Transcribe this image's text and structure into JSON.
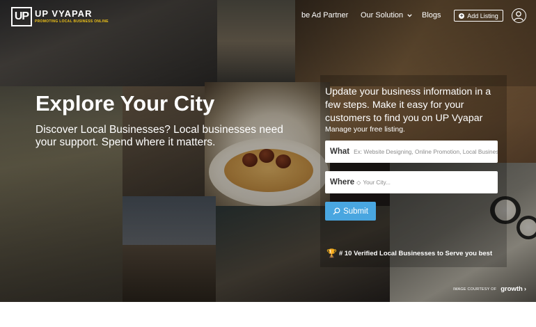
{
  "brand": {
    "logo_mark": "UP",
    "name": "UP VYAPAR",
    "tagline": "PROMOTING LOCAL BUSINESS ONLINE"
  },
  "nav": {
    "items": [
      {
        "label": "be Ad Partner"
      },
      {
        "label": "Our Solution"
      },
      {
        "label": "Blogs"
      }
    ],
    "add_listing": "Add Listing"
  },
  "hero": {
    "title": "Explore Your City",
    "subtitle": "Discover Local Businesses? Local businesses need your support. Spend where it matters."
  },
  "listing_panel": {
    "heading": "Update your business information in a few steps. Make it easy for your customers to find you on UP Vyapar",
    "subheading": "Manage your free listing.",
    "what_label": "What",
    "what_placeholder": "Ex: Website Designing, Online Promotion, Local Business",
    "where_label": "Where",
    "where_placeholder": "Your City...",
    "submit_label": "Submit",
    "verified_text": "# 10 Verified Local Businesses to Serve you best"
  },
  "credit": {
    "prefix": "IMAGE COURTESY OF",
    "brand": "growth",
    "arrow": "›"
  },
  "colors": {
    "accent": "#49a6e0",
    "logo_tagline": "#f0c419",
    "trophy": "#f0b820"
  },
  "icons": {
    "chevron": "chevron-down-icon",
    "add": "plus-circle-icon",
    "user": "user-avatar-icon",
    "location": "location-pin-icon",
    "search": "search-icon",
    "trophy": "trophy-icon"
  }
}
